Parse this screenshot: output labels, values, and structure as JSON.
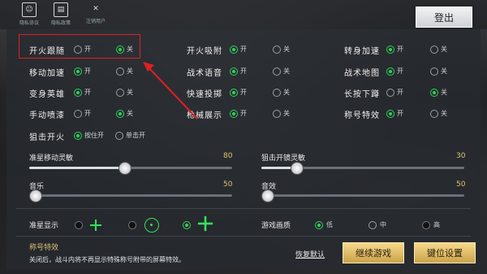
{
  "header": {
    "icon_buttons": [
      {
        "label": "隐私协议",
        "glyph": "☺"
      },
      {
        "label": "隐私政策",
        "glyph": "▤"
      },
      {
        "label": "注销用户",
        "glyph": "✕"
      }
    ],
    "logout_label": "登出"
  },
  "toggles": [
    {
      "label": "开火跟随",
      "options": [
        "开",
        "关"
      ],
      "selected": 1
    },
    {
      "label": "开火吸附",
      "options": [
        "开",
        "关"
      ],
      "selected": 0
    },
    {
      "label": "转身加速",
      "options": [
        "开",
        "关"
      ],
      "selected": 0
    },
    {
      "label": "移动加速",
      "options": [
        "开",
        "关"
      ],
      "selected": 0
    },
    {
      "label": "战术语音",
      "options": [
        "开",
        "关"
      ],
      "selected": 0
    },
    {
      "label": "战术地图",
      "options": [
        "开",
        "关"
      ],
      "selected": 0
    },
    {
      "label": "变身英雄",
      "options": [
        "开",
        "关"
      ],
      "selected": 0
    },
    {
      "label": "快速投掷",
      "options": [
        "开",
        "关"
      ],
      "selected": 0
    },
    {
      "label": "长按下蹲",
      "options": [
        "开",
        "关"
      ],
      "selected": 1
    },
    {
      "label": "手动喷漆",
      "options": [
        "开",
        "关"
      ],
      "selected": 1
    },
    {
      "label": "枪械展示",
      "options": [
        "开",
        "关"
      ],
      "selected": 0
    },
    {
      "label": "称号特效",
      "options": [
        "开",
        "关"
      ],
      "selected": 0
    }
  ],
  "fire_mode": {
    "label": "狙击开火",
    "options": [
      "按住开",
      "单击开"
    ],
    "selected": 0
  },
  "sliders": [
    {
      "label": "准星移动灵敏",
      "value": "80",
      "fraction": 0.8
    },
    {
      "label": "狙击开镜灵敏",
      "value": "30",
      "fraction": 0.3
    },
    {
      "label": "音乐",
      "value": "50",
      "fraction": 0.5
    },
    {
      "label": "音效",
      "value": "50",
      "fraction": 0.5
    }
  ],
  "crosshair": {
    "label": "准星显示",
    "selected": 2,
    "icons": [
      "cross-small",
      "circle-dot",
      "cross-large"
    ]
  },
  "quality": {
    "label": "游戏画质",
    "options": [
      "低",
      "中",
      "高"
    ],
    "selected": 0
  },
  "description": {
    "title": "称号特效",
    "text": "关闭后，战斗内将不再显示特殊称号附带的屏幕特效。"
  },
  "footer": {
    "restore_label": "恢复默认",
    "continue_label": "继续游戏",
    "keybind_label": "键位设置"
  },
  "colors": {
    "accent_green": "#2fd35a",
    "highlight_red": "#e02020",
    "gold": "#e0c46a"
  }
}
